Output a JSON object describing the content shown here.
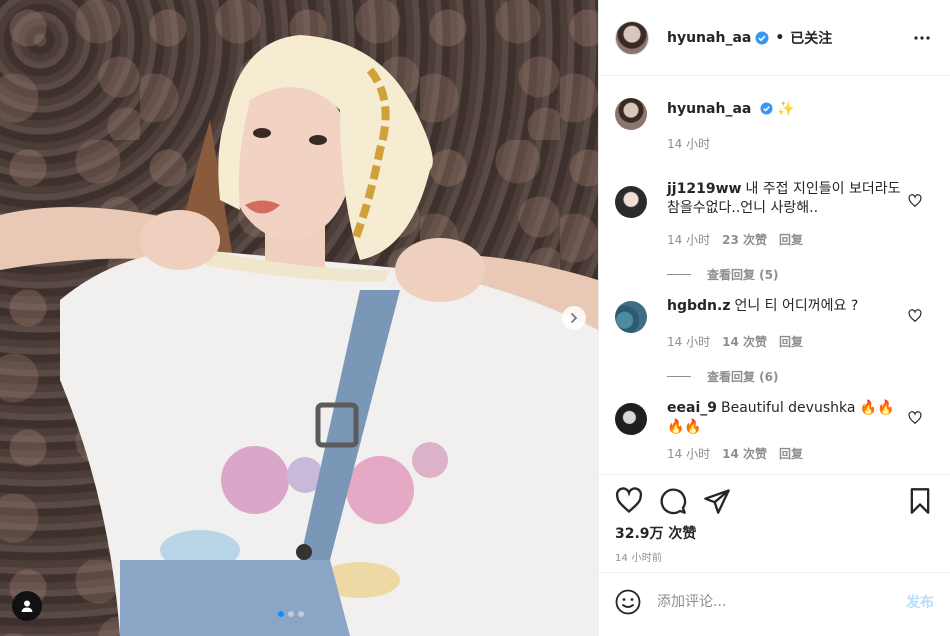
{
  "header": {
    "username": "hyunah_aa",
    "separator": "•",
    "follow_status": "已关注"
  },
  "caption": {
    "username": "hyunah_aa",
    "emoji": "✨",
    "time": "14 小时"
  },
  "comments": [
    {
      "username": "jj1219ww",
      "text": "내 주접 지인들이 보더라도 참을수없다..언니 사랑해..",
      "time": "14 小时",
      "likes": "23 次赞",
      "reply_label": "回复",
      "view_replies": "查看回复 (5)",
      "avatar_color": "#2b2b2b"
    },
    {
      "username": "hgbdn.z",
      "text": "언니 티 어디꺼에요 ?",
      "time": "14 小时",
      "likes": "14 次赞",
      "reply_label": "回复",
      "view_replies": "查看回复 (6)",
      "avatar_color": "#3d6e84"
    },
    {
      "username": "eeai_9",
      "text": "Beautiful devushka 🔥🔥🔥🔥",
      "time": "14 小时",
      "likes": "14 次赞",
      "reply_label": "回复",
      "avatar_color": "#1f1f1f"
    }
  ],
  "actions": {
    "like_icon": "heart-icon",
    "comment_icon": "comment-icon",
    "share_icon": "share-icon",
    "save_icon": "bookmark-icon",
    "likes_count": "32.9万 次赞",
    "time_ago": "14 小时前"
  },
  "composer": {
    "placeholder": "添加评论...",
    "post_label": "发布"
  },
  "media": {
    "carousel_total": 3,
    "carousel_active": 1
  },
  "colors": {
    "verified": "#3897f0",
    "post_disabled": "#b2dffc",
    "carousel_active": "#0095f6"
  }
}
